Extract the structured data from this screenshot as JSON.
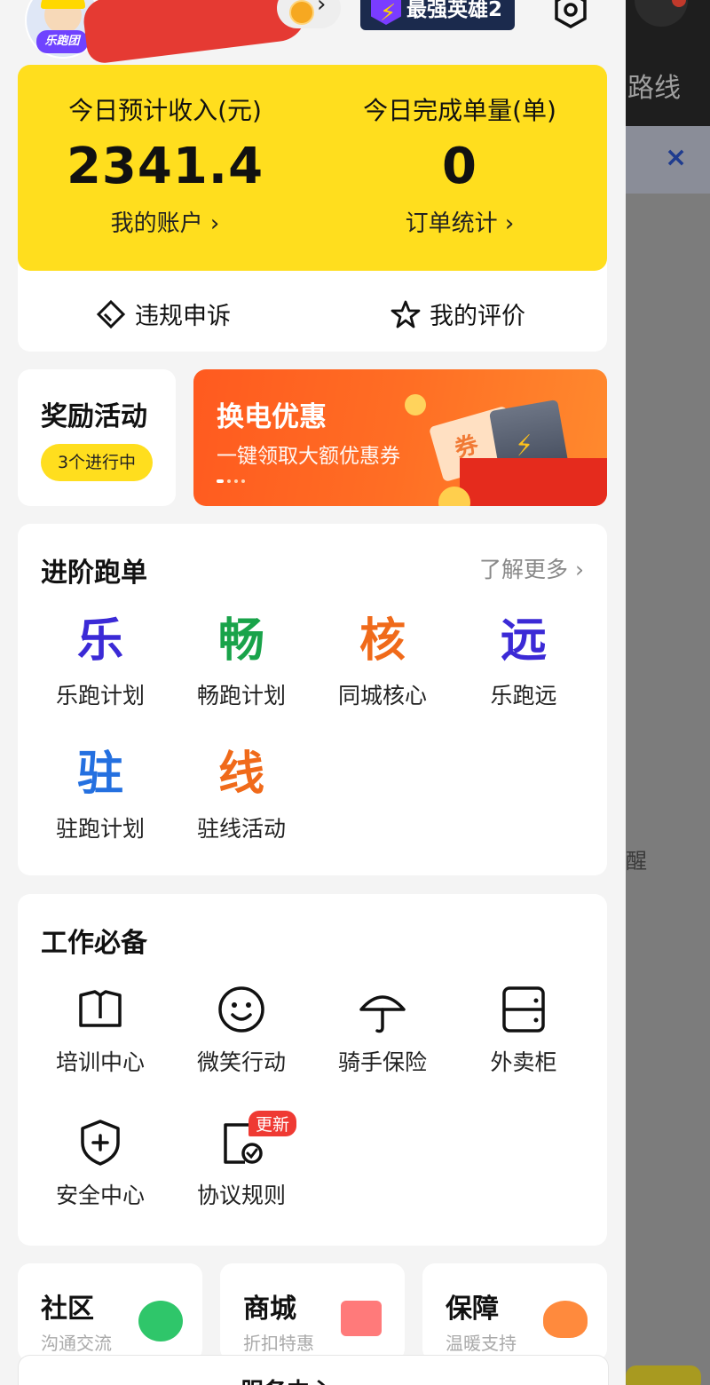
{
  "header": {
    "avatar_badge": "乐跑团",
    "hero_badge": "最强英雄2"
  },
  "income": {
    "label": "今日预计收入(元)",
    "value": "2341.4",
    "link": "我的账户 ›"
  },
  "orders": {
    "label": "今日完成单量(单)",
    "value": "0",
    "link": "订单统计 ›"
  },
  "quick": {
    "appeal": "违规申诉",
    "rating": "我的评价"
  },
  "reward": {
    "title": "奖励活动",
    "pill": "3个进行中"
  },
  "promo": {
    "title": "换电优惠",
    "subtitle": "一键领取大额优惠券",
    "ticket_text": "券"
  },
  "advanced": {
    "title": "进阶跑单",
    "more": "了解更多 ›",
    "items": [
      {
        "glyph": "乐",
        "label": "乐跑计划",
        "color": "#3b2ad6"
      },
      {
        "glyph": "畅",
        "label": "畅跑计划",
        "color": "#19a34a"
      },
      {
        "glyph": "核",
        "label": "同城核心",
        "color": "#f06a1a"
      },
      {
        "glyph": "远",
        "label": "乐跑远",
        "color": "#3b2ad6"
      },
      {
        "glyph": "驻",
        "label": "驻跑计划",
        "color": "#2470e0"
      },
      {
        "glyph": "线",
        "label": "驻线活动",
        "color": "#f06a1a"
      }
    ]
  },
  "work": {
    "title": "工作必备",
    "items": [
      {
        "icon": "book-icon",
        "label": "培训中心"
      },
      {
        "icon": "smile-icon",
        "label": "微笑行动"
      },
      {
        "icon": "umbrella-icon",
        "label": "骑手保险"
      },
      {
        "icon": "cabinet-icon",
        "label": "外卖柜"
      },
      {
        "icon": "shield-plus-icon",
        "label": "安全中心"
      },
      {
        "icon": "document-check-icon",
        "label": "协议规则",
        "tag": "更新"
      }
    ]
  },
  "bottom_cards": [
    {
      "title": "社区",
      "subtitle": "沟通交流",
      "icon": "chat-icon",
      "color": "#2fc66a"
    },
    {
      "title": "商城",
      "subtitle": "折扣特惠",
      "icon": "gift-icon",
      "color": "#ff7a7a"
    },
    {
      "title": "保障",
      "subtitle": "温暖支持",
      "icon": "heart-icon",
      "color": "#ff8a3d"
    }
  ],
  "dock_label": "服务中心",
  "background_page": {
    "route_text": "路线",
    "close_symbol": "×",
    "side_text": "醒"
  }
}
